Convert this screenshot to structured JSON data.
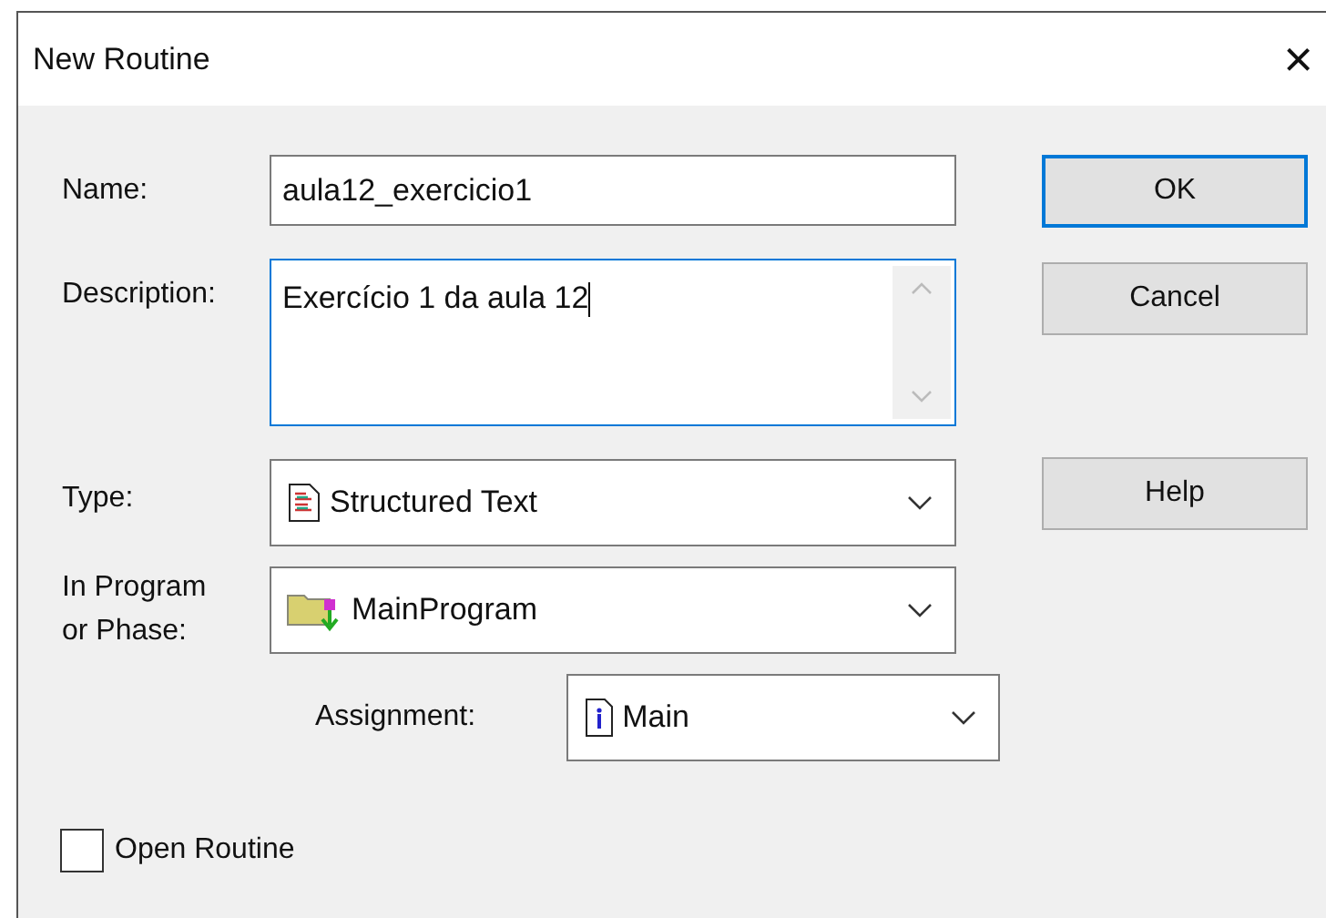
{
  "window": {
    "title": "New Routine",
    "close": "×"
  },
  "fields": [
    {
      "label": "Name:",
      "value": "aula12_exercicio1",
      "kind": "text",
      "focused": false
    },
    {
      "label": "Description:",
      "value": "Exercício 1 da aula 12",
      "kind": "textarea",
      "focused": true
    }
  ],
  "type": {
    "label": "Type:",
    "value": "Structured Text"
  },
  "program": {
    "label": "In Program\nor Phase:",
    "value": "MainProgram"
  },
  "assignment": {
    "label": "Assignment:",
    "value": "Main"
  },
  "buttons": [
    {
      "label": "OK",
      "default": true
    },
    {
      "label": "Cancel",
      "default": false
    },
    {
      "label": "Help",
      "default": false
    }
  ],
  "open_routine": {
    "label": "Open Routine",
    "checked": false
  }
}
